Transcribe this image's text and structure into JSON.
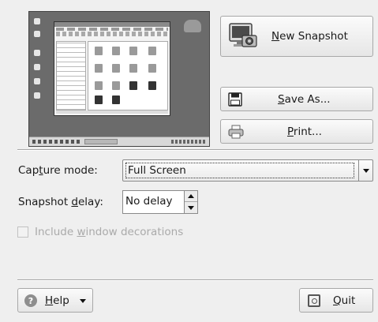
{
  "buttons": {
    "new_snapshot": {
      "pre": "",
      "acc": "N",
      "post": "ew Snapshot"
    },
    "save_as": {
      "pre": "",
      "acc": "S",
      "post": "ave As..."
    },
    "print": {
      "pre": "",
      "acc": "P",
      "post": "rint..."
    },
    "help": {
      "pre": "",
      "acc": "H",
      "post": "elp"
    },
    "quit": {
      "pre": "",
      "acc": "Q",
      "post": "uit"
    }
  },
  "capture_mode": {
    "label_pre": "Cap",
    "label_acc": "t",
    "label_post": "ure mode:",
    "value": "Full Screen"
  },
  "snapshot_delay": {
    "label_pre": "Snapshot ",
    "label_acc": "d",
    "label_post": "elay:",
    "value": "No delay"
  },
  "include_decorations": {
    "label_pre": "Include ",
    "label_acc": "w",
    "label_post": "indow decorations",
    "checked": false,
    "enabled": false
  },
  "icons": {
    "preview": "desktop-screenshot-preview",
    "new_snapshot": "camera-monitor-icon",
    "save_as": "floppy-disk-icon",
    "print": "printer-icon",
    "help": "help-icon",
    "quit": "quit-icon"
  }
}
